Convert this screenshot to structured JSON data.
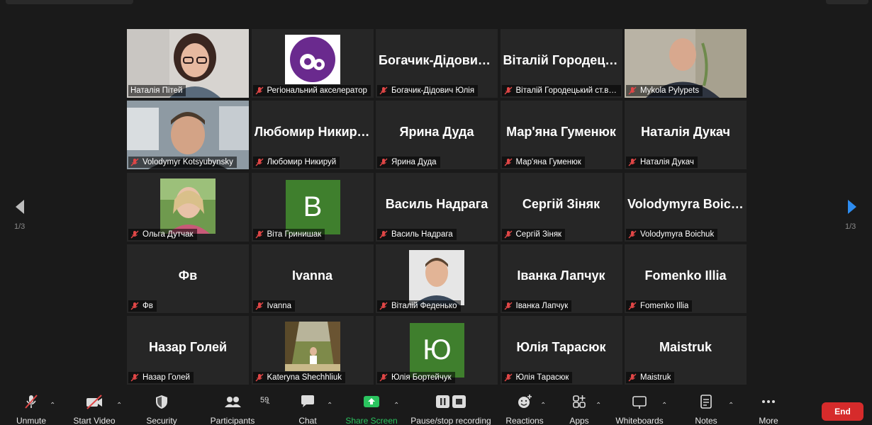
{
  "pagination": {
    "left": "1/3",
    "right": "1/3"
  },
  "tiles": [
    {
      "big": "",
      "label": "Наталія Пітей"
    },
    {
      "big": "",
      "label": "Регіональний акселератор"
    },
    {
      "big": "Богачик-Дідович Юлія",
      "label": "Богачик-Дідович Юлія"
    },
    {
      "big": "Віталій Городецький",
      "label": "Віталій Городецький ст.викл."
    },
    {
      "big": "",
      "label": "Mykola Pylypets"
    },
    {
      "big": "",
      "label": "Volodymyr Kotsyubynsky"
    },
    {
      "big": "Любомир Никируй",
      "label": "Любомир Никируй"
    },
    {
      "big": "Ярина Дуда",
      "label": "Ярина Дуда"
    },
    {
      "big": "Мар'яна Гуменюк",
      "label": "Мар'яна Гуменюк"
    },
    {
      "big": "Наталія Дукач",
      "label": "Наталія Дукач"
    },
    {
      "big": "",
      "label": "Ольга Дутчак"
    },
    {
      "big": "B",
      "label": "Віта Гринишак"
    },
    {
      "big": "Василь Надрага",
      "label": "Василь Надрага"
    },
    {
      "big": "Сергій Зіняк",
      "label": "Сергій Зіняк"
    },
    {
      "big": "Volodymyra Boichuk",
      "label": "Volodymyra Boichuk"
    },
    {
      "big": "Фв",
      "label": "Фв"
    },
    {
      "big": "Ivanna",
      "label": "Ivanna"
    },
    {
      "big": "",
      "label": "Віталій Феденько"
    },
    {
      "big": "Іванка Лапчук",
      "label": "Іванка Лапчук"
    },
    {
      "big": "Fomenko Illia",
      "label": "Fomenko Illia"
    },
    {
      "big": "Назар Голей",
      "label": "Назар Голей"
    },
    {
      "big": "",
      "label": "Kateryna Shechhliuk"
    },
    {
      "big": "Ю",
      "label": "Юлія Бортейчук"
    },
    {
      "big": "Юлія Тарасюк",
      "label": "Юлія Тарасюк"
    },
    {
      "big": "Maistruk",
      "label": "Maistruk"
    }
  ],
  "toolbar": {
    "unmute": "Unmute",
    "start_video": "Start Video",
    "security": "Security",
    "participants": "Participants",
    "participants_count": "59",
    "chat": "Chat",
    "share_screen": "Share Screen",
    "pause_recording": "Pause/stop recording",
    "reactions": "Reactions",
    "apps": "Apps",
    "whiteboards": "Whiteboards",
    "notes": "Notes",
    "more": "More",
    "end": "End"
  },
  "colors": {
    "active_speaker_border": "#c7e155",
    "avatar_green": "#3f7f2d",
    "share_green": "#2bc45f",
    "end_red": "#d62b2b",
    "arrow_blue": "#2d8cf0",
    "muted_red": "#e04646"
  },
  "icons": {
    "muted_mic": "muted-mic-icon",
    "next_page": "chevron-right-icon",
    "prev_page": "chevron-left-icon"
  }
}
